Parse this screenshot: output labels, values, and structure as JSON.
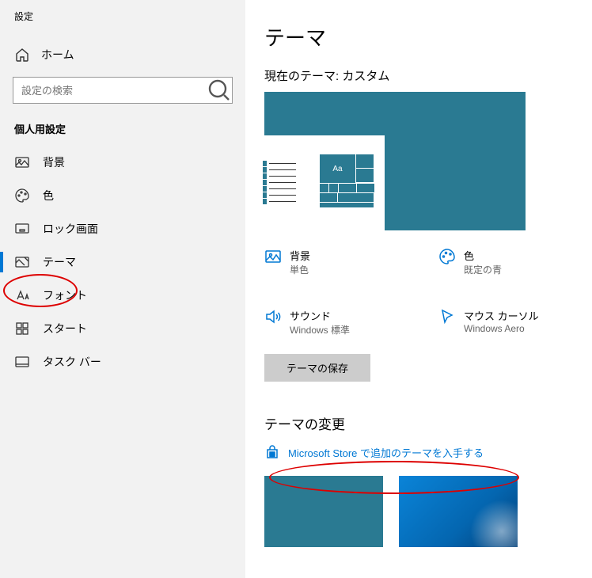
{
  "window_title": "設定",
  "home_label": "ホーム",
  "search_placeholder": "設定の検索",
  "section_header": "個人用設定",
  "nav": {
    "background": "背景",
    "color": "色",
    "lockscreen": "ロック画面",
    "themes": "テーマ",
    "fonts": "フォント",
    "start": "スタート",
    "taskbar": "タスク バー"
  },
  "main": {
    "title": "テーマ",
    "current_theme": "現在のテーマ: カスタム",
    "preview_tile_label": "Aa",
    "opts": {
      "bg": {
        "title": "背景",
        "sub": "単色"
      },
      "color": {
        "title": "色",
        "sub": "既定の青"
      },
      "sound": {
        "title": "サウンド",
        "sub": "Windows 標準"
      },
      "cursor": {
        "title": "マウス カーソル",
        "sub": "Windows Aero"
      }
    },
    "save_button": "テーマの保存",
    "change_title": "テーマの変更",
    "store_link": "Microsoft Store で追加のテーマを入手する"
  }
}
